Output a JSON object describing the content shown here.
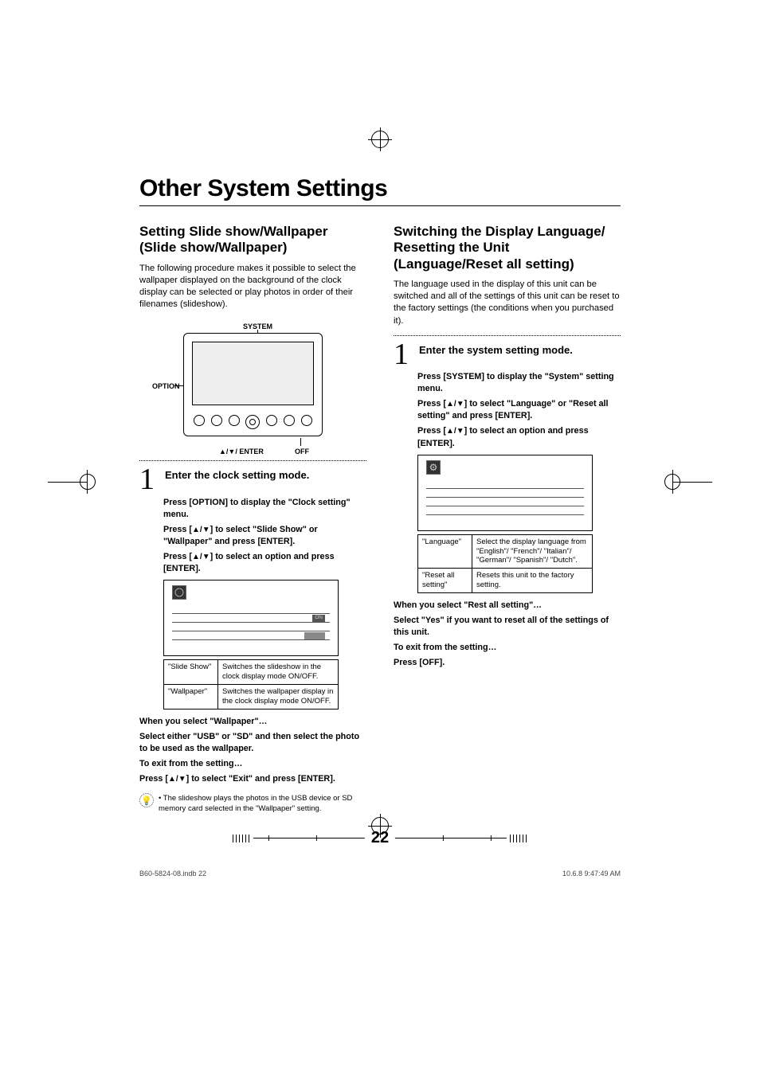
{
  "page": {
    "main_title": "Other System Settings",
    "page_number": "22"
  },
  "left": {
    "subtitle": "Setting Slide show/Wallpaper (Slide show/Wallpaper)",
    "intro": "The following procedure makes it possible to select the wallpaper displayed on the background of the clock display can be selected or play photos in order of their filenames (slideshow).",
    "labels": {
      "system": "SYSTEM",
      "option": "OPTION",
      "updown_enter": "▲/▼/ ENTER",
      "off": "OFF"
    },
    "step1_title": "Enter the clock setting mode.",
    "instr1": "Press [OPTION] to display the \"Clock setting\" menu.",
    "instr2_pre": "Press [",
    "instr2_post": "] to select \"Slide Show\" or \"Wallpaper\" and press [ENTER].",
    "instr3_pre": "Press [",
    "instr3_post": "] to select an option and press [ENTER].",
    "menu_val": "ON",
    "table": [
      {
        "k": "\"Slide Show\"",
        "v": "Switches the slideshow in the clock display mode ON/OFF."
      },
      {
        "k": "\"Wallpaper\"",
        "v": "Switches the wallpaper display in the clock display mode ON/OFF."
      }
    ],
    "when_wallpaper_title": "When you select \"Wallpaper\"…",
    "when_wallpaper_body": "Select either \"USB\" or \"SD\" and then select the photo to be used as the wallpaper.",
    "exit_title": "To exit from the setting…",
    "exit_body_pre": "Press [",
    "exit_body_post": "] to select \"Exit\" and press [ENTER].",
    "tip": "The slideshow plays the photos in the USB device or SD memory card selected in the \"Wallpaper\" setting."
  },
  "right": {
    "subtitle": "Switching the Display Language/ Resetting the Unit (Language/Reset all setting)",
    "intro": "The language used in the display of this unit can be switched and all of the settings of this unit can be reset to the factory settings (the conditions when you purchased it).",
    "step1_title": "Enter the system setting mode.",
    "instr1": "Press [SYSTEM] to display the \"System\" setting menu.",
    "instr2_pre": "Press [",
    "instr2_post": "] to select \"Language\" or \"Reset all setting\" and press [ENTER].",
    "instr3_pre": "Press [",
    "instr3_post": "] to select an option and press [ENTER].",
    "table": [
      {
        "k": "\"Language\"",
        "v": "Select the display language from \"English\"/ \"French\"/ \"Italian\"/ \"German\"/ \"Spanish\"/ \"Dutch\"."
      },
      {
        "k": "\"Reset all setting\"",
        "v": "Resets this unit to the factory setting."
      }
    ],
    "when_reset_title": "When you select \"Rest all setting\"…",
    "when_reset_body": "Select \"Yes\" if you want to reset all of the settings of this unit.",
    "exit_title": "To exit from the setting…",
    "exit_body": "Press [OFF]."
  },
  "footer": {
    "left": "B60-5824-08.indb   22",
    "right": "10.6.8   9:47:49 AM"
  }
}
